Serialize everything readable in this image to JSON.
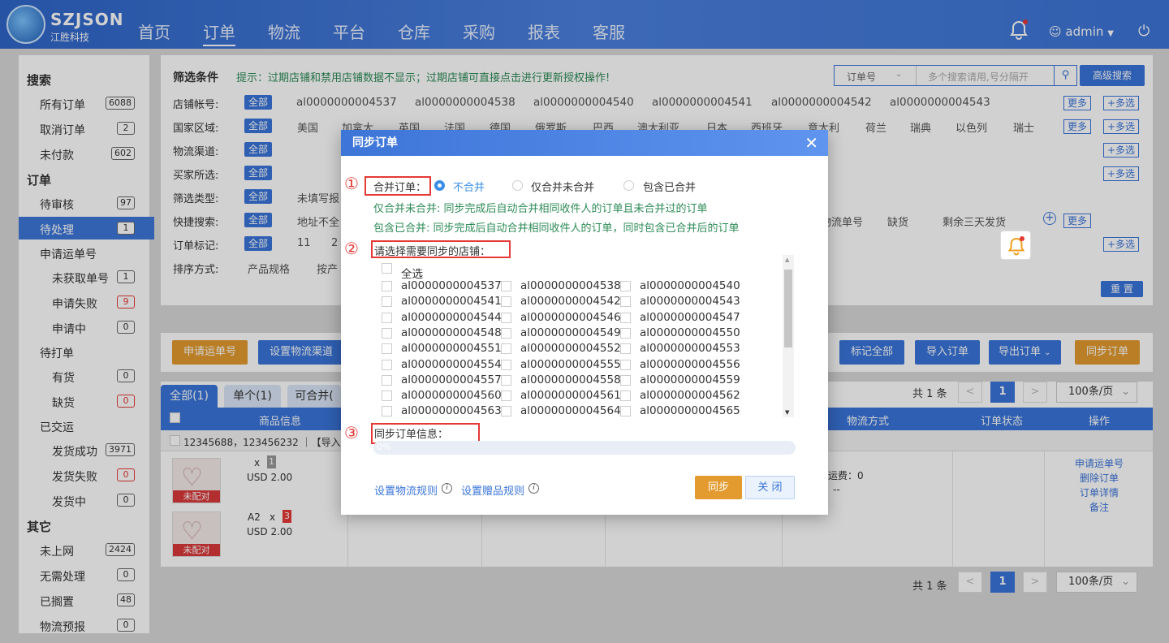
{
  "header": {
    "logo_text": "SZJSON",
    "logo_sub": "江胜科技",
    "nav": [
      "首页",
      "订单",
      "物流",
      "平台",
      "仓库",
      "采购",
      "报表",
      "客服"
    ],
    "user": "admin"
  },
  "sidebar": {
    "sections": [
      {
        "title": "搜索",
        "items": [
          {
            "label": "所有订单",
            "count": "6088"
          },
          {
            "label": "取消订单",
            "count": "2"
          },
          {
            "label": "未付款",
            "count": "602"
          }
        ]
      },
      {
        "title": "订单",
        "items": [
          {
            "label": "待审核",
            "count": "97"
          },
          {
            "label": "待处理",
            "count": "1"
          },
          {
            "label": "申请运单号"
          },
          {
            "label": "未获取单号",
            "count": "1"
          },
          {
            "label": "申请失败",
            "count": "9"
          },
          {
            "label": "申请中",
            "count": "0"
          },
          {
            "label": "待打单"
          },
          {
            "label": "有货",
            "count": "0"
          },
          {
            "label": "缺货",
            "count": "0"
          },
          {
            "label": "已交运"
          },
          {
            "label": "发货成功",
            "count": "3971"
          },
          {
            "label": "发货失败",
            "count": "0"
          },
          {
            "label": "发货中",
            "count": "0"
          }
        ]
      },
      {
        "title": "其它",
        "items": [
          {
            "label": "未上网",
            "count": "2424"
          },
          {
            "label": "无需处理",
            "count": "0"
          },
          {
            "label": "已搁置",
            "count": "48"
          },
          {
            "label": "物流预报",
            "count": "0"
          }
        ]
      }
    ]
  },
  "filter": {
    "title": "筛选条件",
    "tip": "提示：过期店铺和禁用店铺数据不显示；过期店铺可直接点击进行更新授权操作!",
    "search_select": "订单号",
    "search_placeholder": "多个搜索请用,号分隔开",
    "adv_search": "高级搜索",
    "all": "全部",
    "more": "更多",
    "multi": "+多选",
    "reset": "重 置",
    "rows": {
      "shop": "店铺帐号:",
      "country": "国家区域:",
      "channel": "物流渠道:",
      "buyer": "买家所选:",
      "type": "筛选类型:",
      "quick": "快捷搜索:",
      "mark": "订单标记:",
      "sort": "排序方式:"
    },
    "shops": [
      "al0000000004537",
      "al0000000004538",
      "al0000000004540",
      "al0000000004541",
      "al0000000004542",
      "al0000000004543"
    ],
    "countries": [
      "美国",
      "加拿大",
      "英国",
      "法国",
      "德国",
      "俄罗斯",
      "巴西",
      "澳大利亚",
      "日本",
      "西班牙",
      "意大利",
      "荷兰",
      "瑞典",
      "以色列",
      "瑞士"
    ],
    "type_opt": "未填写报",
    "quick_opts": [
      "地址不全",
      "物流单号",
      "缺货",
      "剩余三天发货"
    ],
    "mark_opts": [
      "11",
      "2"
    ],
    "sort_opts": [
      "产品规格",
      "按产"
    ]
  },
  "actions": {
    "left": [
      "申请运单号",
      "设置物流渠道"
    ],
    "right": [
      "标记全部",
      "导入订单",
      "导出订单",
      "同步订单"
    ]
  },
  "tabs": [
    "全部(1)",
    "单个(1)",
    "可合并("
  ],
  "pagination": {
    "total": "共 1 条",
    "page": "1",
    "per_page": "100条/页"
  },
  "table": {
    "headers": [
      "商品信息",
      "物流方式",
      "订单状态",
      "操作"
    ],
    "order_ids": "12345688，123456232 ｜【导入订",
    "items": [
      {
        "qty_prefix": "x",
        "qty": "1",
        "price": "USD 2.00",
        "tag": "未配对"
      },
      {
        "sku": "A2",
        "qty_prefix": "x",
        "qty": "3",
        "price": "USD 2.00",
        "tag": "未配对"
      }
    ],
    "freight": "运费：0",
    "freight2": "：--",
    "ops": [
      "申请运单号",
      "删除订单",
      "订单详情",
      "备注"
    ]
  },
  "modal": {
    "title": "同步订单",
    "merge_label": "合并订单：",
    "merge_opts": [
      "不合并",
      "仅合并未合并",
      "包含已合并"
    ],
    "desc1": "仅合并未合并: 同步完成后自动合并相同收件人的订单且未合并过的订单",
    "desc2": "包含已合并: 同步完成后自动合并相同收件人的订单，同时包含已合并后的订单",
    "shops_label": "请选择需要同步的店铺：",
    "select_all": "全选",
    "shops": [
      "al0000000004537",
      "al0000000004538",
      "al0000000004540",
      "al0000000004541",
      "al0000000004542",
      "al0000000004543",
      "al0000000004544",
      "al0000000004546",
      "al0000000004547",
      "al0000000004548",
      "al0000000004549",
      "al0000000004550",
      "al0000000004551",
      "al0000000004552",
      "al0000000004553",
      "al0000000004554",
      "al0000000004555",
      "al0000000004556",
      "al0000000004557",
      "al0000000004558",
      "al0000000004559",
      "al0000000004560",
      "al0000000004561",
      "al0000000004562",
      "al0000000004563",
      "al0000000004564",
      "al0000000004565"
    ],
    "info_label": "同步订单信息：",
    "progress": "0%",
    "progress_value": 0,
    "link1": "设置物流规则",
    "link2": "设置赠品规则",
    "sync": "同步",
    "close": "关 闭",
    "markers": [
      "①",
      "②",
      "③"
    ]
  }
}
